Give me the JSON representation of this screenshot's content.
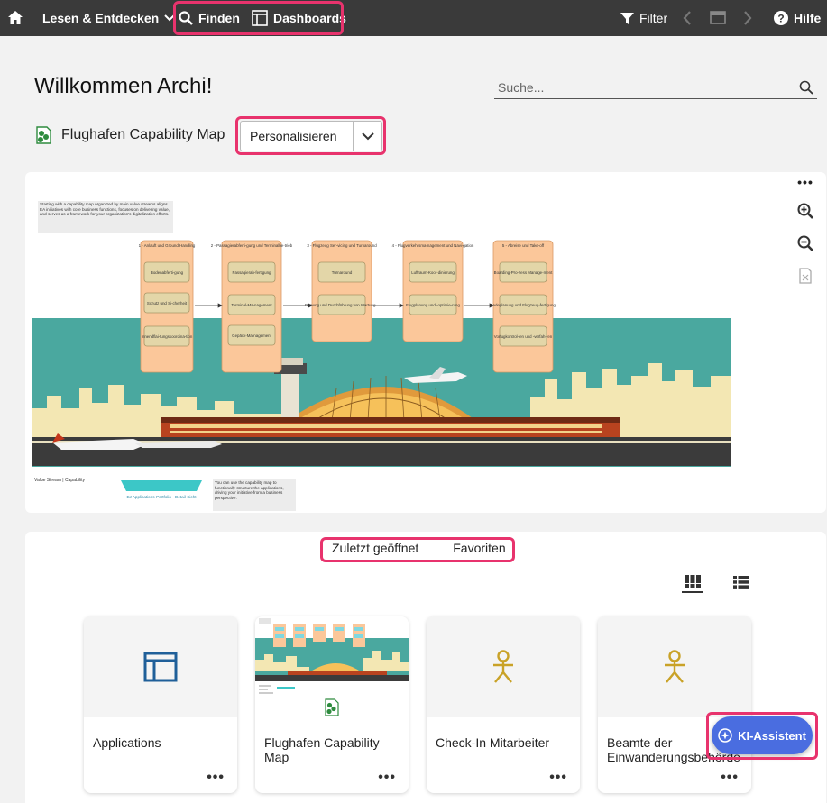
{
  "topbar": {
    "explore_label": "Lesen & Entdecken",
    "find_label": "Finden",
    "dashboards_label": "Dashboards",
    "filter_label": "Filter",
    "help_label": "Hilfe"
  },
  "header": {
    "welcome": "Willkommen Archi!",
    "search_placeholder": "Suche..."
  },
  "dashboard": {
    "title": "Flughafen Capability Map",
    "personalize_label": "Personalisieren"
  },
  "map": {
    "intro_text": "Starting with a capability map organized by main value streams aligns EA initiatives with core business functions, focuses on delivering value, and serves as a framework for your organization's digitalization efforts.",
    "legend_text": "Value Stream | Capability",
    "portfolio_link": "EJ Applications-Portfolio - Detail-Sicht",
    "note_text": "You can use the capability map to functionally structure the applications, driving your initiative from a business perspective.",
    "streams": [
      {
        "title": "1 - Anlauft und Ground Handling",
        "caps": [
          "Bodenabferti-gung",
          "Schutz und Si-cherheit",
          "Innendflai-tungskoordina-tion"
        ]
      },
      {
        "title": "2 - Passagierabferti-gung und Terminalbe-trieb",
        "caps": [
          "Passagierab-fertigung",
          "Terminal-Ma-nagement",
          "Gepäck-Ma-nagement"
        ]
      },
      {
        "title": "3 - Flugzeug Ser-vicing und Turnaround",
        "caps": [
          "Turnaround",
          "Planung und Durchführung von Wartung..."
        ]
      },
      {
        "title": "4 - Flugverkehrsma-nagement und Navi-gation",
        "caps": [
          "Luftraum-Koor-dinierung",
          "Flugplanung und -optimie-rung"
        ]
      },
      {
        "title": "5 - Abreise und Take-off",
        "caps": [
          "Boarding-Pro-zess Manage-ment",
          "Ladeplanung und Flugzeug-fertigung",
          "Vorfugkontrol-len und -verfah-ren"
        ]
      }
    ]
  },
  "lower": {
    "tab_recent": "Zuletzt geöffnet",
    "tab_favorites": "Favoriten",
    "cards": [
      {
        "name": "Applications",
        "icon": "dashboard-layout-icon"
      },
      {
        "name": "Flughafen Capability Map",
        "icon": "capability-map-thumbnail"
      },
      {
        "name": "Check-In Mitarbeiter",
        "icon": "person-icon"
      },
      {
        "name": "Beamte der Einwanderungsbehörde",
        "icon": "person-icon"
      }
    ]
  },
  "assistant": {
    "label": "KI-Assistent"
  },
  "colors": {
    "topbar": "#3a3a3a",
    "highlight": "#e8336d",
    "stream": "#fbc79a",
    "capability": "#e3d6a8",
    "sky": "#4aa89f",
    "accent": "#4a6de0",
    "person_icon": "#c9a227",
    "layout_icon": "#1f5f99"
  }
}
